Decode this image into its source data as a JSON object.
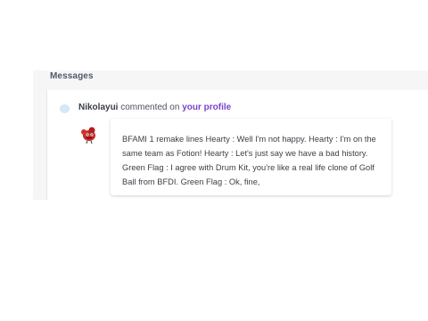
{
  "messages": {
    "title": "Messages",
    "comment": {
      "user": "Nikolayui",
      "action": "commented on",
      "target": "your profile",
      "body": "BFAMI 1 remake lines Hearty : Well I'm not happy. Hearty : I'm on the same team as Fotion! Hearty : Let's just say we have a bad history. Green Flag : I agree with Drum Kit, you're like a real life clone of Golf Ball from BFDI. Green Flag : Ok, fine,"
    }
  },
  "colors": {
    "panel_bg": "#f6f6f7",
    "link": "#7a44c9",
    "unread_dot": "#d4e8f6"
  },
  "icons": {
    "avatar": "red-creature-avatar",
    "unread": "unread-dot"
  }
}
